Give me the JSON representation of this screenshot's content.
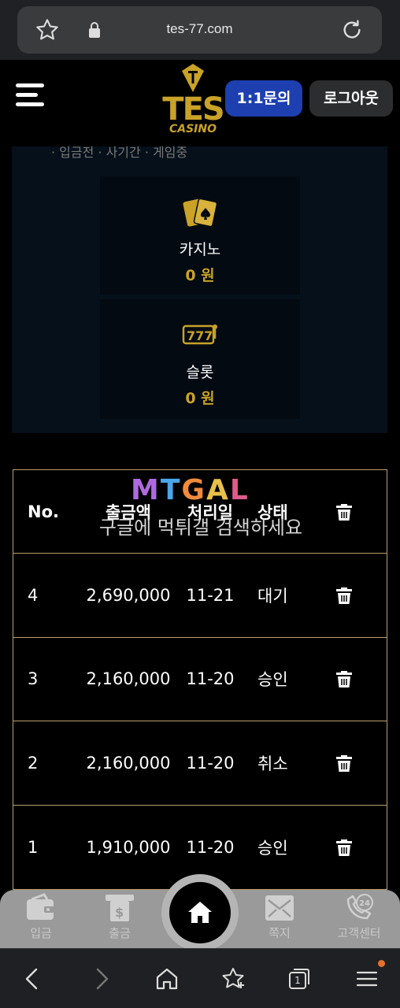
{
  "browser": {
    "url": "tes-77.com",
    "tabs_count": "1"
  },
  "header": {
    "logo_text": "TES",
    "logo_sub": "CASINO",
    "inquiry_label": "1:1문의",
    "logout_label": "로그아웃"
  },
  "balances": {
    "cut_text": "· 입금전 · 사기간 · 게임중",
    "casino": {
      "label": "카지노",
      "value": "0 원"
    },
    "slot": {
      "label": "슬롯",
      "value": "0 원"
    }
  },
  "table": {
    "headers": {
      "no": "No.",
      "amount": "출금액",
      "date": "처리일",
      "status": "상태"
    },
    "rows": [
      {
        "no": "4",
        "amount": "2,690,000",
        "date": "11-21",
        "status": "대기"
      },
      {
        "no": "3",
        "amount": "2,160,000",
        "date": "11-20",
        "status": "승인"
      },
      {
        "no": "2",
        "amount": "2,160,000",
        "date": "11-20",
        "status": "취소"
      },
      {
        "no": "1",
        "amount": "1,910,000",
        "date": "11-20",
        "status": "승인"
      }
    ]
  },
  "watermark": {
    "logo": "MTGAL",
    "text": "구글에 먹튀갤 검색하세요"
  },
  "bottom_nav": {
    "deposit": "입금",
    "withdraw": "출금",
    "notice": "쪽지",
    "support": "고객센터"
  },
  "colors": {
    "gold": "#c9a227",
    "inquiry_blue": "#1d3fb0",
    "table_border": "#b8a06a",
    "nav_bg": "#9a9a9a"
  }
}
